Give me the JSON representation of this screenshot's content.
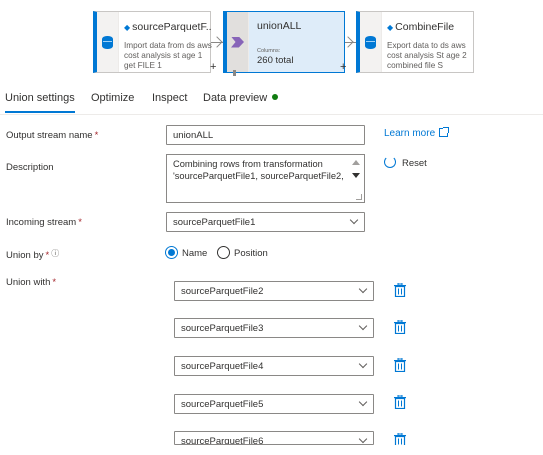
{
  "flow": {
    "source_node": {
      "title": "sourceParquetF...",
      "description": "Import data from ds aws cost analysis st age 1 get FILE 1"
    },
    "union_node": {
      "title": "unionALL",
      "columns_label": "Columns:",
      "total": "260 total"
    },
    "sink_node": {
      "title": "CombineFile",
      "description": "Export data to ds aws cost analysis St age 2 combined file S"
    },
    "add_symbol": "+"
  },
  "tabs": [
    {
      "label": "Union settings",
      "active": true
    },
    {
      "label": "Optimize",
      "active": false
    },
    {
      "label": "Inspect",
      "active": false
    },
    {
      "label": "Data preview",
      "active": false,
      "status_color": "#107c10"
    }
  ],
  "form": {
    "output_stream": {
      "label": "Output stream name",
      "required_mark": "*",
      "value": "unionALL"
    },
    "description": {
      "label": "Description",
      "value": "Combining rows from transformation 'sourceParquetFile1, sourceParquetFile2,"
    },
    "learn_more": "Learn more",
    "reset": "Reset",
    "incoming_stream": {
      "label": "Incoming stream",
      "required_mark": "*",
      "value": "sourceParquetFile1"
    },
    "union_by": {
      "label": "Union by",
      "required_mark": "*",
      "info_symbol": "ⓘ",
      "options": [
        {
          "label": "Name",
          "selected": true
        },
        {
          "label": "Position",
          "selected": false
        }
      ]
    },
    "union_with": {
      "label": "Union with",
      "required_mark": "*",
      "streams": [
        "sourceParquetFile2",
        "sourceParquetFile3",
        "sourceParquetFile4",
        "sourceParquetFile5",
        "sourceParquetFile6"
      ]
    }
  },
  "colors": {
    "accent": "#0078d4",
    "union_icon": "#8764b8",
    "required": "#a4262c"
  }
}
